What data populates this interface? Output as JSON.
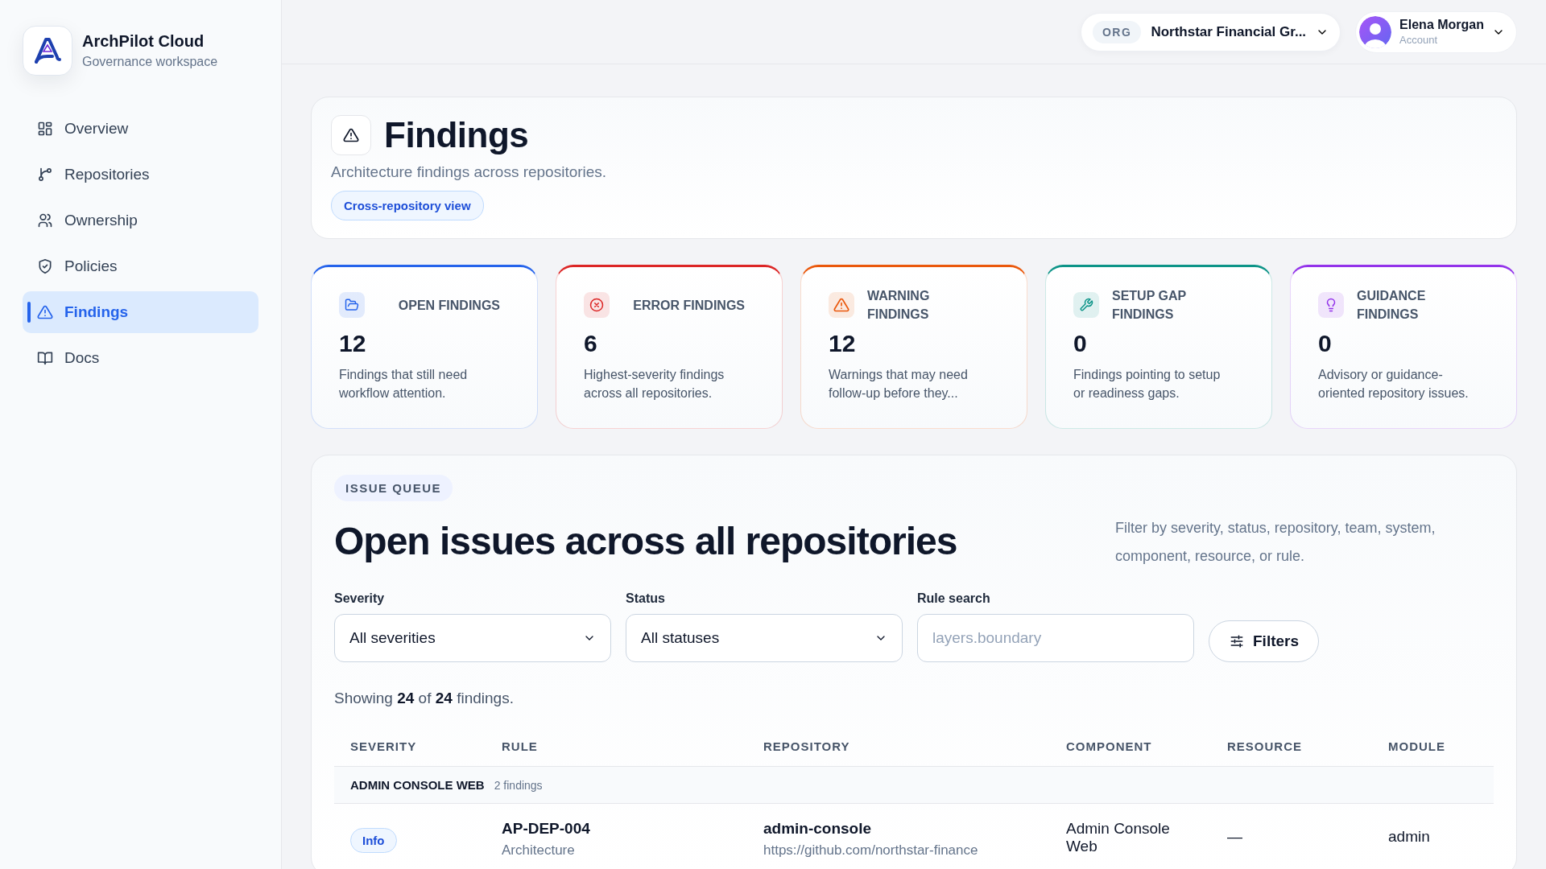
{
  "brand": {
    "name": "ArchPilot Cloud",
    "subtitle": "Governance workspace"
  },
  "nav": [
    {
      "label": "Overview",
      "selected": false
    },
    {
      "label": "Repositories",
      "selected": false
    },
    {
      "label": "Ownership",
      "selected": false
    },
    {
      "label": "Policies",
      "selected": false
    },
    {
      "label": "Findings",
      "selected": true
    },
    {
      "label": "Docs",
      "selected": false
    }
  ],
  "org": {
    "tag": "ORG",
    "name": "Northstar Financial Gr..."
  },
  "account": {
    "name": "Elena Morgan",
    "caption": "Account"
  },
  "header": {
    "title": "Findings",
    "subtitle": "Architecture findings across repositories.",
    "chip": "Cross-repository view"
  },
  "stats": [
    {
      "label": "OPEN FINDINGS",
      "value": "12",
      "description": "Findings that still need workflow attention.",
      "color": "#2563eb"
    },
    {
      "label": "ERROR FINDINGS",
      "value": "6",
      "description": "Highest-severity findings across all repositories.",
      "color": "#dc2626"
    },
    {
      "label": "WARNING FINDINGS",
      "value": "12",
      "description": "Warnings that may need follow-up before they...",
      "color": "#ea580c"
    },
    {
      "label": "SETUP GAP FINDINGS",
      "value": "0",
      "description": "Findings pointing to setup or readiness gaps.",
      "color": "#0d9488"
    },
    {
      "label": "GUIDANCE FINDINGS",
      "value": "0",
      "description": "Advisory or guidance-oriented repository issues.",
      "color": "#9333ea"
    }
  ],
  "queue": {
    "eyebrow": "ISSUE QUEUE",
    "title": "Open issues across all repositories",
    "hint": "Filter by severity, status, repository, team, system, component, resource, or rule.",
    "filters": [
      {
        "label": "Severity",
        "kind": "select",
        "value": "All severities"
      },
      {
        "label": "Status",
        "kind": "select",
        "value": "All statuses"
      },
      {
        "label": "Rule search",
        "kind": "search",
        "placeholder": "layers.boundary"
      }
    ],
    "filters_button": "Filters",
    "summary": "Showing **24** of **24** findings."
  },
  "table": {
    "columns": [
      "SEVERITY",
      "RULE",
      "REPOSITORY",
      "COMPONENT",
      "RESOURCE",
      "MODULE"
    ],
    "groups": [
      {
        "name": "ADMIN CONSOLE WEB",
        "count": "2 findings",
        "rows": [
          {
            "severity": "Info",
            "rule": "AP-DEP-004",
            "rule_sub": "Architecture",
            "repository": "admin-console",
            "repository_sub": "https://github.com/northstar-finance",
            "component": "Admin Console Web",
            "resource": "—",
            "module": "admin"
          }
        ]
      }
    ]
  }
}
